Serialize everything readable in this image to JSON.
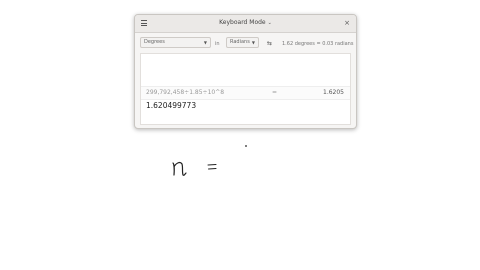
{
  "window": {
    "title": "Keyboard Mode",
    "title_chevron": "⌄",
    "menu_icon": "hamburger-icon",
    "close_glyph": "×"
  },
  "conversion": {
    "from_unit": "Degrees",
    "in_label": "in",
    "to_unit": "Radians",
    "swap_glyph": "⇆",
    "result_text": "1.62 degrees = 0.03 radians"
  },
  "display": {
    "history_expression": "299,792,458÷1.85÷10^8",
    "history_equals": "=",
    "history_answer": "1.6205",
    "current_entry": "1.620499773"
  },
  "annotation": {
    "handwritten_text": "n ="
  },
  "colors": {
    "window_bg": "#f6f5f4",
    "titlebar_bg": "#ebe9e7",
    "display_bg": "#ffffff",
    "ink": "#222222"
  }
}
